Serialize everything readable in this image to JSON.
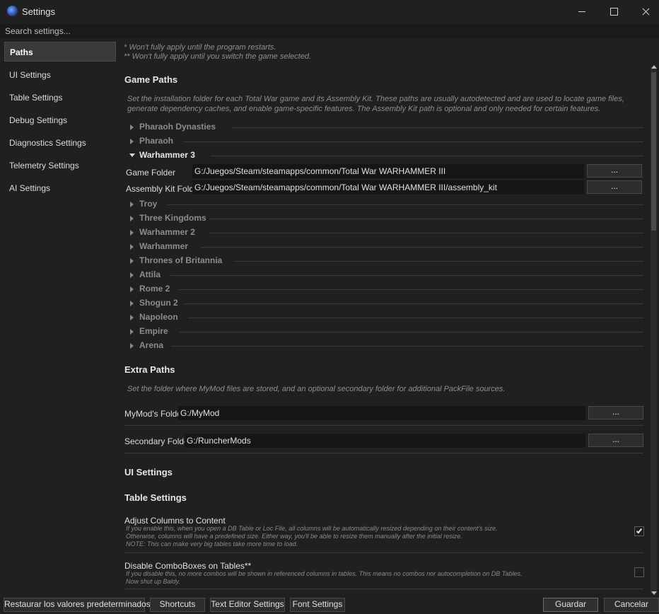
{
  "window": {
    "title": "Settings",
    "icon": "rpfm-app-icon"
  },
  "search": {
    "placeholder": "Search settings..."
  },
  "sidebar": {
    "items": [
      {
        "label": "Paths",
        "active": true
      },
      {
        "label": "UI Settings"
      },
      {
        "label": "Table Settings"
      },
      {
        "label": "Debug Settings"
      },
      {
        "label": "Diagnostics Settings"
      },
      {
        "label": "Telemetry Settings"
      },
      {
        "label": "AI Settings"
      }
    ]
  },
  "notes": {
    "restart": "* Won't fully apply until the program restarts.",
    "switch_game": "** Won't fully apply until you switch the game selected."
  },
  "game_paths": {
    "heading": "Game Paths",
    "description_line1": "Set the installation folder for each Total War game and its Assembly Kit. These paths are usually autodetected and are used to locate game files,",
    "description_line2": "generate dependency caches, and enable game-specific features. The Assembly Kit path is optional and only needed for certain features.",
    "games": [
      {
        "name": "Pharaoh Dynasties",
        "expanded": false
      },
      {
        "name": "Pharaoh",
        "expanded": false
      },
      {
        "name": "Warhammer 3",
        "expanded": true
      },
      {
        "name": "Troy",
        "expanded": false
      },
      {
        "name": "Three Kingdoms",
        "expanded": false
      },
      {
        "name": "Warhammer 2",
        "expanded": false
      },
      {
        "name": "Warhammer",
        "expanded": false
      },
      {
        "name": "Thrones of Britannia",
        "expanded": false
      },
      {
        "name": "Attila",
        "expanded": false
      },
      {
        "name": "Rome 2",
        "expanded": false
      },
      {
        "name": "Shogun 2",
        "expanded": false
      },
      {
        "name": "Napoleon",
        "expanded": false
      },
      {
        "name": "Empire",
        "expanded": false
      },
      {
        "name": "Arena",
        "expanded": false
      }
    ],
    "wh3": {
      "game_folder_label": "Game Folder",
      "game_folder_value": "G:/Juegos/Steam/steamapps/common/Total War WARHAMMER III",
      "assembly_kit_label": "Assembly Kit Folder",
      "assembly_kit_value": "G:/Juegos/Steam/steamapps/common/Total War WARHAMMER III/assembly_kit",
      "browse_label": "..."
    }
  },
  "extra_paths": {
    "heading": "Extra Paths",
    "description": "Set the folder where MyMod files are stored, and an optional secondary folder for additional PackFile sources.",
    "mymod_label": "MyMod's Folder",
    "mymod_value": "G:/MyMod",
    "secondary_label": "Secondary Folder",
    "secondary_value": "G:/RuncherMods",
    "browse_label": "..."
  },
  "ui_settings": {
    "heading": "UI Settings"
  },
  "table_settings": {
    "heading": "Table Settings",
    "options": [
      {
        "title": "Adjust Columns to Content",
        "desc1": "If you enable this, when you open a DB Table or Loc File, all columns will be automatically resized depending on their content's size.",
        "desc2": "Otherwise, columns will have a predefined size. Either way, you'll be able to resize them manually after the initial resize.",
        "desc3": "NOTE: This can make very big tables take more time to load.",
        "checked": true
      },
      {
        "title": "Disable ComboBoxes on Tables**",
        "desc1": "If you disable this, no more combos will be shown in referenced columns in tables. This means no combos nor autocompletion on DB Tables.",
        "desc2": "Now shut up Baldy.",
        "checked": false
      }
    ]
  },
  "footer": {
    "restore_defaults": "Restaurar los valores predeterminados",
    "shortcuts": "Shortcuts",
    "text_editor_settings": "Text Editor Settings",
    "font_settings": "Font Settings",
    "save": "Guardar",
    "cancel": "Cancelar"
  },
  "colors": {
    "background": "#202020",
    "input_bg": "#161616",
    "muted_text": "#8e8e8e"
  }
}
